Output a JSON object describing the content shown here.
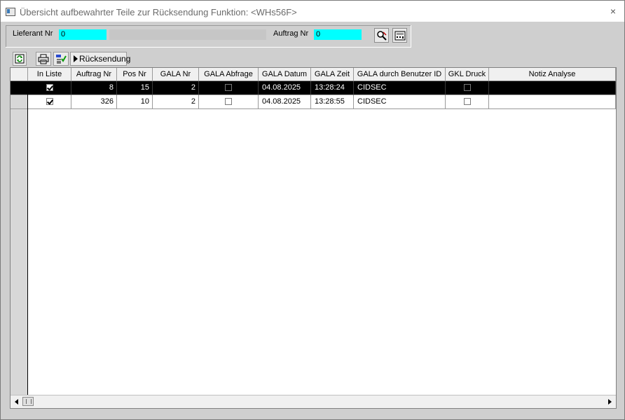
{
  "window": {
    "title": "Übersicht aufbewahrter Teile zur Rücksendung Funktion: <WHs56F>",
    "close_glyph": "×"
  },
  "header": {
    "lieferant_label": "Lieferant Nr",
    "lieferant_value": "0",
    "auftrag_label": "Auftrag Nr",
    "auftrag_value": "0"
  },
  "toolbar": {
    "ruecksendung_label": "Rücksendung"
  },
  "table": {
    "columns": [
      "In Liste",
      "Auftrag Nr",
      "Pos Nr",
      "GALA Nr",
      "GALA Abfrage",
      "GALA Datum",
      "GALA Zeit",
      "GALA durch Benutzer ID",
      "GKL Druck",
      "Notiz Analyse"
    ],
    "rows": [
      {
        "in_liste": true,
        "auftrag_nr": "8",
        "pos_nr": "15",
        "gala_nr": "2",
        "gala_abfrage": false,
        "gala_datum": "04.08.2025",
        "gala_zeit": "13:28:24",
        "benutzer_id": "CIDSEC",
        "gkl_druck": false,
        "notiz": "",
        "selected": true
      },
      {
        "in_liste": true,
        "auftrag_nr": "326",
        "pos_nr": "10",
        "gala_nr": "2",
        "gala_abfrage": false,
        "gala_datum": "04.08.2025",
        "gala_zeit": "13:28:55",
        "benutzer_id": "CIDSEC",
        "gkl_druck": false,
        "notiz": "",
        "selected": false
      }
    ]
  },
  "colors": {
    "input_bg": "#00ffff",
    "selected_row": "#000000",
    "window_bg": "#cfcfcf"
  },
  "icons": [
    "refresh-icon",
    "printer-icon",
    "ok-check-icon",
    "search-icon",
    "calculator-icon"
  ]
}
